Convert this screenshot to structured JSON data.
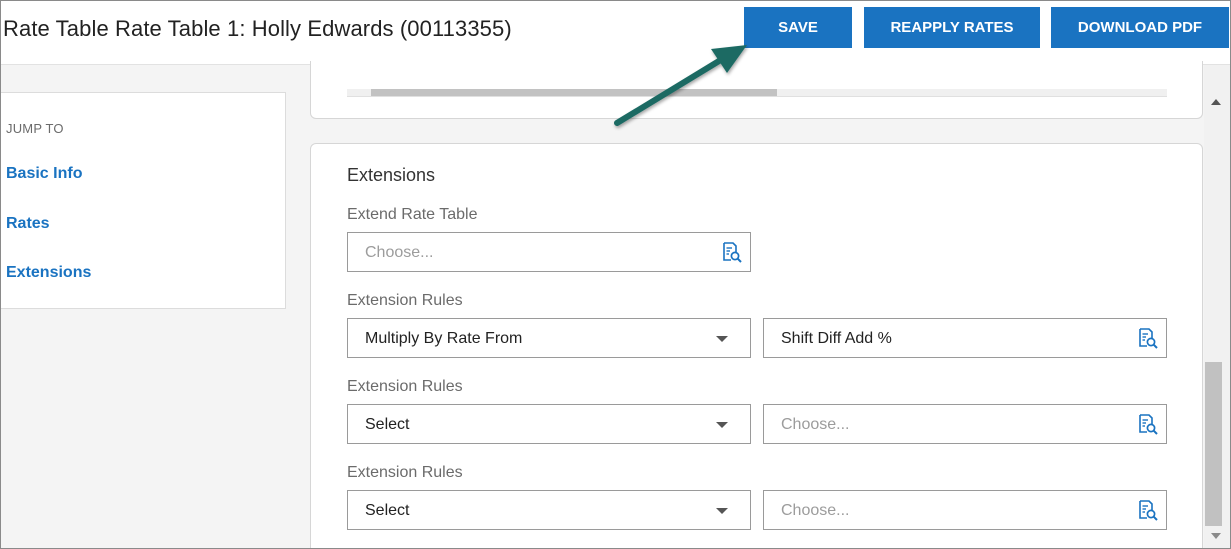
{
  "header": {
    "title": "Rate Table Rate Table 1: Holly Edwards (00113355)",
    "buttons": {
      "save": "SAVE",
      "reapply": "REAPPLY RATES",
      "download": "DOWNLOAD PDF"
    }
  },
  "sidebar": {
    "heading": "JUMP TO",
    "items": [
      {
        "label": "Basic Info"
      },
      {
        "label": "Rates"
      },
      {
        "label": "Extensions"
      }
    ]
  },
  "extensions": {
    "title": "Extensions",
    "extend_rate_table": {
      "label": "Extend Rate Table",
      "placeholder": "Choose..."
    },
    "rules": [
      {
        "label": "Extension Rules",
        "select_value": "Multiply By Rate From",
        "lookup_value": "Shift Diff Add %",
        "lookup_is_placeholder": false
      },
      {
        "label": "Extension Rules",
        "select_value": "Select",
        "lookup_value": "Choose...",
        "lookup_is_placeholder": true
      },
      {
        "label": "Extension Rules",
        "select_value": "Select",
        "lookup_value": "Choose...",
        "lookup_is_placeholder": true
      }
    ]
  },
  "icons": {
    "lookup": "lookup-search-icon",
    "caret": "chevron-down-icon",
    "annotation": "annotation-arrow-icon"
  },
  "colors": {
    "primary": "#1a73c1",
    "annotation_arrow": "#1d6b64"
  }
}
